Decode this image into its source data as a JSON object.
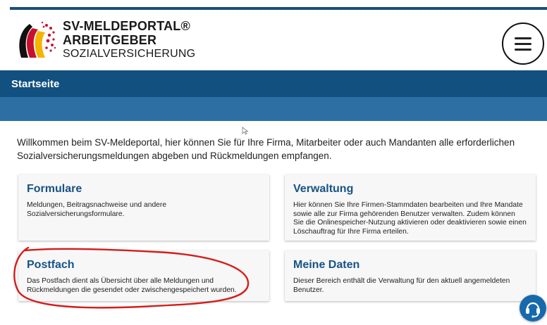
{
  "header": {
    "brand_line1": "SV-MELDEPORTAL®",
    "brand_line2": "ARBEITGEBER",
    "brand_line3": "SOZIALVERSICHERUNG",
    "menu_icon": "hamburger-icon"
  },
  "nav": {
    "title": "Startseite"
  },
  "intro": "Willkommen beim SV-Meldeportal, hier können Sie für Ihre Firma, Mitarbeiter oder auch Mandanten alle erforderlichen Sozialversicherungsmeldungen abgeben und Rückmeldungen empfangen.",
  "cards": [
    {
      "title": "Formulare",
      "desc": "Meldungen, Beitragsnachweise und andere Sozialversicherungsformulare."
    },
    {
      "title": "Verwaltung",
      "desc": "Hier können Sie Ihre Firmen-Stammdaten bearbeiten und Ihre Mandate sowie alle zur Firma gehörenden Benutzer verwalten. Zudem können Sie die Onlinespeicher-Nutzung aktivieren oder deaktivieren sowie einen Löschauftrag für Ihre Firma erteilen."
    },
    {
      "title": "Postfach",
      "desc": "Das Postfach dient als Übersicht über alle Meldungen und Rückmeldungen die gesendet oder zwischengespeichert wurden."
    },
    {
      "title": "Meine Daten",
      "desc": "Dieser Bereich enthält die Verwaltung für den aktuell angemeldeten Benutzer."
    }
  ],
  "help_icon": "headset-icon",
  "colors": {
    "nav_primary": "#11507f",
    "nav_secondary": "#2c6fa3",
    "card_title": "#175384",
    "annotation": "#d61c1c",
    "help_button": "#1769ad"
  }
}
